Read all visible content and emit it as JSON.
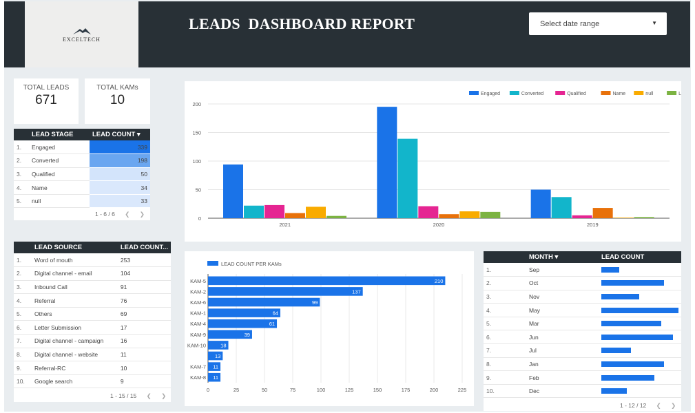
{
  "header": {
    "logo_text": "EXCELTECH",
    "title": "LEADS  DASHBOARD REPORT",
    "date_range_placeholder": "Select date range"
  },
  "kpis": {
    "total_leads_label": "TOTAL LEADS",
    "total_leads_value": "671",
    "total_kams_label": "TOTAL KAMs",
    "total_kams_value": "10"
  },
  "lead_stage_table": {
    "headers": [
      "LEAD STAGE",
      "LEAD COUNT ▾"
    ],
    "rows": [
      {
        "idx": "1.",
        "stage": "Engaged",
        "count": "339",
        "color": "#1a73e8"
      },
      {
        "idx": "2.",
        "stage": "Converted",
        "count": "198",
        "color": "#6aa6f0"
      },
      {
        "idx": "3.",
        "stage": "Qualified",
        "count": "50",
        "color": "#d3e4fb"
      },
      {
        "idx": "4.",
        "stage": "Name",
        "count": "34",
        "color": "#dae8fc"
      },
      {
        "idx": "5.",
        "stage": "null",
        "count": "33",
        "color": "#dae8fc"
      }
    ],
    "pager": "1 - 6 / 6"
  },
  "lead_source_table": {
    "headers": [
      "LEAD SOURCE",
      "LEAD COUNT..."
    ],
    "rows": [
      {
        "idx": "1.",
        "source": "Word of mouth",
        "count": "253"
      },
      {
        "idx": "2.",
        "source": "Digital channel - email",
        "count": "104"
      },
      {
        "idx": "3.",
        "source": "Inbound Call",
        "count": "91"
      },
      {
        "idx": "4.",
        "source": "Referral",
        "count": "76"
      },
      {
        "idx": "5.",
        "source": "Others",
        "count": "69"
      },
      {
        "idx": "6.",
        "source": "Letter Submission",
        "count": "17"
      },
      {
        "idx": "7.",
        "source": "Digital channel - campaign",
        "count": "16"
      },
      {
        "idx": "8.",
        "source": "Digital channel - website",
        "count": "11"
      },
      {
        "idx": "9.",
        "source": "Referral-RC",
        "count": "10"
      },
      {
        "idx": "10.",
        "source": "Google search",
        "count": "9"
      }
    ],
    "pager": "1 - 15 / 15"
  },
  "month_table": {
    "headers": [
      "MONTH ▾",
      "LEAD COUNT"
    ],
    "rows": [
      {
        "idx": "1.",
        "month": "Sep",
        "value": 24
      },
      {
        "idx": "2.",
        "month": "Oct",
        "value": 83
      },
      {
        "idx": "3.",
        "month": "Nov",
        "value": 50
      },
      {
        "idx": "4.",
        "month": "May",
        "value": 102
      },
      {
        "idx": "5.",
        "month": "Mar",
        "value": 79
      },
      {
        "idx": "6.",
        "month": "Jun",
        "value": 95
      },
      {
        "idx": "7.",
        "month": "Jul",
        "value": 39
      },
      {
        "idx": "8.",
        "month": "Jan",
        "value": 83
      },
      {
        "idx": "9.",
        "month": "Feb",
        "value": 70
      },
      {
        "idx": "10.",
        "month": "Dec",
        "value": 34
      }
    ],
    "max": 102,
    "pager": "1 - 12 / 12"
  },
  "chart_data": [
    {
      "type": "bar",
      "categories": [
        "2021",
        "2020",
        "2019"
      ],
      "series": [
        {
          "name": "Engaged",
          "color": "#1a73e8",
          "values": [
            94,
            195,
            50
          ]
        },
        {
          "name": "Converted",
          "color": "#12b5cb",
          "values": [
            22,
            139,
            37
          ]
        },
        {
          "name": "Qualified",
          "color": "#e52592",
          "values": [
            23,
            21,
            5
          ]
        },
        {
          "name": "Name",
          "color": "#e8710a",
          "values": [
            9,
            7,
            18
          ]
        },
        {
          "name": "null",
          "color": "#f9ab00",
          "values": [
            20,
            12,
            1
          ]
        },
        {
          "name": "Lost",
          "color": "#7cb342",
          "values": [
            4,
            11,
            2
          ]
        }
      ],
      "ylim": [
        0,
        200
      ],
      "yticks": [
        "0",
        "50",
        "100",
        "150",
        "200"
      ],
      "legend": "top-right"
    },
    {
      "type": "bar",
      "orientation": "horizontal",
      "series": [
        {
          "name": "LEAD COUNT PER KAMs",
          "color": "#1a73e8"
        }
      ],
      "categories": [
        "KAM-5",
        "KAM-2",
        "KAM-6",
        "KAM-1",
        "KAM-4",
        "KAM-9",
        "KAM-10",
        "",
        "KAM-7",
        "KAM-8"
      ],
      "values": [
        210,
        137,
        99,
        64,
        61,
        39,
        18,
        13,
        11,
        11
      ],
      "xlim": [
        0,
        225
      ],
      "xticks": [
        "0",
        "25",
        "50",
        "75",
        "100",
        "125",
        "150",
        "175",
        "200",
        "225"
      ]
    }
  ]
}
